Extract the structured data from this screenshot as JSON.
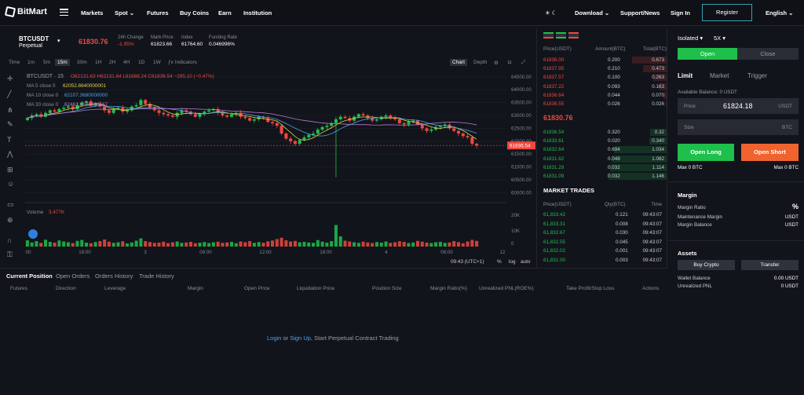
{
  "nav": {
    "brand": "BitMart",
    "links": [
      "Markets",
      "Spot",
      "Futures",
      "Buy Coins",
      "Earn",
      "Institution"
    ],
    "download": "Download",
    "support": "Support/News",
    "signin": "Sign In",
    "register": "Register",
    "language": "English"
  },
  "ticker": {
    "symbol": "BTCUSDT",
    "type": "Perpetual",
    "last_price": "61830.76",
    "change_label": "24h Change",
    "change_value": "-1.95%",
    "mark_label": "Mark Price",
    "mark_value": "61823.66",
    "index_label": "Index",
    "index_value": "61764.60",
    "funding_label": "Funding Rate",
    "funding_value": "0.046996%"
  },
  "timeframes": {
    "items": [
      "Time",
      "1m",
      "5m",
      "15m",
      "30m",
      "1H",
      "2H",
      "4H",
      "1D",
      "1W"
    ],
    "active": "15m",
    "indicators": "Indicators",
    "view_chart": "Chart",
    "view_depth": "Depth"
  },
  "chart": {
    "legend_symbol": "BTCUSDT · 15",
    "ohlc": "O62131.63 H62131.64 L61688.24 C61836.54 −295.10 (−0.47%)",
    "ma5": "MA 5 close 0",
    "ma5_value": "62052.8640000001",
    "ma10": "MA 10 close 0",
    "ma10_value": "62107.3680000000",
    "ma30": "MA 30 close 0",
    "ma30_value": "62462.0536666667",
    "volume_label": "Volume",
    "volume_value": "3.477K",
    "price_tag": "61836.54",
    "time_readout": "09:43 (UTC+1)",
    "pct_btn": "%",
    "log_btn": "log",
    "auto_btn": "auto",
    "colors": {
      "up": "#1fbf4b",
      "down": "#f0483f",
      "ma5": "#e6d14a",
      "ma10": "#4aa5e6",
      "ma30": "#b67bd6"
    }
  },
  "chart_data": {
    "type": "candlestick",
    "title": "BTCUSDT · 15",
    "price_ticks": [
      "64500.00",
      "64000.00",
      "63500.00",
      "63000.00",
      "62500.00",
      "62000.00",
      "61500.00",
      "61000.00",
      "60500.00",
      "60000.00"
    ],
    "volume_ticks": [
      "20K",
      "10K",
      "0"
    ],
    "x_ticks": [
      "00",
      "18:00",
      "3",
      "06:00",
      "12:00",
      "18:00",
      "4",
      "06:00",
      "12"
    ],
    "ylim": [
      59800,
      64800
    ],
    "closes": [
      62900,
      63000,
      63050,
      62950,
      63100,
      63200,
      63150,
      63250,
      63300,
      63350,
      63250,
      63400,
      63500,
      63550,
      63400,
      63450,
      63350,
      63200,
      63100,
      63250,
      63300,
      63150,
      63200,
      63350,
      63400,
      63600,
      63450,
      63300,
      63200,
      63100,
      63050,
      63000,
      62950,
      63100,
      63200,
      63150,
      63050,
      62950,
      63050,
      63150,
      63200,
      63250,
      63100,
      63000,
      62950,
      63050,
      63100,
      62950,
      62900,
      62800,
      62850,
      62950,
      62900,
      62750,
      62700,
      62600,
      62300,
      62100,
      62000,
      61900,
      62050,
      62150,
      62250,
      62300,
      62450,
      62550,
      62600,
      62700,
      62850,
      62950,
      62900,
      62800,
      62950,
      63050,
      63000,
      62900,
      62800,
      62850,
      62950,
      63000,
      62900,
      62850,
      62700,
      62650,
      62750,
      62800,
      62650,
      62500,
      62400,
      62450,
      62550,
      62600,
      62650,
      62500,
      62400,
      62300,
      62200,
      62150,
      61900,
      61836
    ],
    "volumes": [
      3.2,
      2.1,
      2.8,
      1.9,
      3.5,
      2.4,
      2.0,
      3.1,
      2.6,
      2.2,
      1.8,
      2.9,
      3.4,
      2.0,
      1.7,
      2.3,
      2.8,
      3.6,
      2.5,
      1.9,
      2.2,
      2.7,
      1.6,
      2.1,
      3.0,
      4.2,
      2.8,
      2.3,
      1.9,
      2.0,
      2.5,
      1.8,
      2.2,
      2.6,
      1.9,
      2.1,
      2.4,
      1.7,
      2.0,
      2.3,
      1.8,
      2.2,
      2.5,
      1.9,
      2.1,
      2.4,
      1.7,
      2.6,
      2.2,
      2.8,
      1.9,
      2.3,
      2.0,
      2.7,
      3.1,
      3.8,
      4.5,
      3.2,
      2.6,
      2.9,
      2.2,
      2.4,
      2.1,
      1.9,
      3.3,
      2.5,
      2.0,
      2.8,
      11.0,
      5.2,
      3.0,
      2.6,
      2.2,
      1.9,
      2.5,
      2.1,
      1.8,
      2.3,
      2.0,
      2.6,
      1.9,
      2.2,
      2.7,
      2.4,
      1.8,
      2.1,
      2.9,
      2.5,
      2.0,
      1.8,
      2.2,
      2.4,
      1.9,
      2.1,
      2.8,
      2.3,
      1.7,
      2.6,
      3.4,
      2.9
    ]
  },
  "orderbook": {
    "col_price": "Price(USDT)",
    "col_amount": "Amount(BTC)",
    "col_total": "Total(BTC)",
    "asks": [
      {
        "price": "61838.00",
        "amount": "0.200",
        "total": "0.673",
        "depth": 0.59
      },
      {
        "price": "61837.95",
        "amount": "0.210",
        "total": "0.473",
        "depth": 0.41
      },
      {
        "price": "61837.57",
        "amount": "0.100",
        "total": "0.263",
        "depth": 0.23
      },
      {
        "price": "61837.22",
        "amount": "0.093",
        "total": "0.163",
        "depth": 0.14
      },
      {
        "price": "61836.64",
        "amount": "0.044",
        "total": "0.070",
        "depth": 0.06
      },
      {
        "price": "61836.55",
        "amount": "0.026",
        "total": "0.026",
        "depth": 0.02
      }
    ],
    "mid_price": "61830.76",
    "bids": [
      {
        "price": "61836.54",
        "amount": "0.320",
        "total": "0.32",
        "depth": 0.28
      },
      {
        "price": "61833.61",
        "amount": "0.020",
        "total": "0.340",
        "depth": 0.3
      },
      {
        "price": "61832.64",
        "amount": "0.694",
        "total": "1.034",
        "depth": 0.9
      },
      {
        "price": "61831.62",
        "amount": "0.048",
        "total": "1.082",
        "depth": 0.94
      },
      {
        "price": "61831.29",
        "amount": "0.032",
        "total": "1.114",
        "depth": 0.97
      },
      {
        "price": "61831.09",
        "amount": "0.032",
        "total": "1.146",
        "depth": 1.0
      }
    ]
  },
  "trades": {
    "title": "MARKET TRADES",
    "col_price": "Price(USDT)",
    "col_qty": "Qty(BTC)",
    "col_time": "Time",
    "rows": [
      {
        "price": "61,833.42",
        "qty": "0.121",
        "time": "09:43:07"
      },
      {
        "price": "61,833.31",
        "qty": "0.008",
        "time": "09:43:07"
      },
      {
        "price": "61,832.67",
        "qty": "0.030",
        "time": "09:43:07"
      },
      {
        "price": "61,832.55",
        "qty": "0.045",
        "time": "09:43:07"
      },
      {
        "price": "61,832.02",
        "qty": "0.001",
        "time": "09:43:07"
      },
      {
        "price": "61,831.00",
        "qty": "0.003",
        "time": "09:43:07"
      }
    ]
  },
  "panel": {
    "margin_mode": "Isolated",
    "leverage": "5X",
    "open_tab": "Open",
    "close_tab": "Close",
    "order_types": [
      "Limit",
      "Market",
      "Trigger"
    ],
    "available": "Available Balance: 0 USDT",
    "price_label": "Price",
    "price_value": "61824.18",
    "price_unit": "USDT",
    "size_label": "Size",
    "size_unit": "BTC",
    "open_long": "Open Long",
    "open_short": "Open Short",
    "max_long": "Max 0 BTC",
    "max_short": "Max 0 BTC",
    "margin_title": "Margin",
    "margin_ratio": "Margin Ratio",
    "margin_ratio_val": "%",
    "maint_margin": "Maintenance Margin",
    "maint_margin_val": "USDT",
    "margin_balance": "Margin Balance",
    "margin_balance_val": "USDT",
    "assets_title": "Assets",
    "buy_crypto": "Buy Crypto",
    "transfer": "Transfer",
    "wallet_balance": "Wallet Balance",
    "wallet_balance_val": "0.00 USDT",
    "unrealized": "Unrealized PNL",
    "unrealized_val": "0 USDT"
  },
  "positions": {
    "tabs": [
      "Current Position",
      "Open Orders",
      "Orders History",
      "Trade History"
    ],
    "columns": [
      "Futures",
      "Direction",
      "Leverage",
      "Margin",
      "Open Price",
      "Liquidation Price",
      "Position Size",
      "Margin Ratio(%)",
      "Unrealized PNL(ROE%)",
      "Take Profit/Stop Loss",
      "Actions"
    ],
    "login": "Login",
    "or": "or",
    "signup": "Sign Up",
    "empty_text": ", Start Perpetual Contract Trading"
  }
}
